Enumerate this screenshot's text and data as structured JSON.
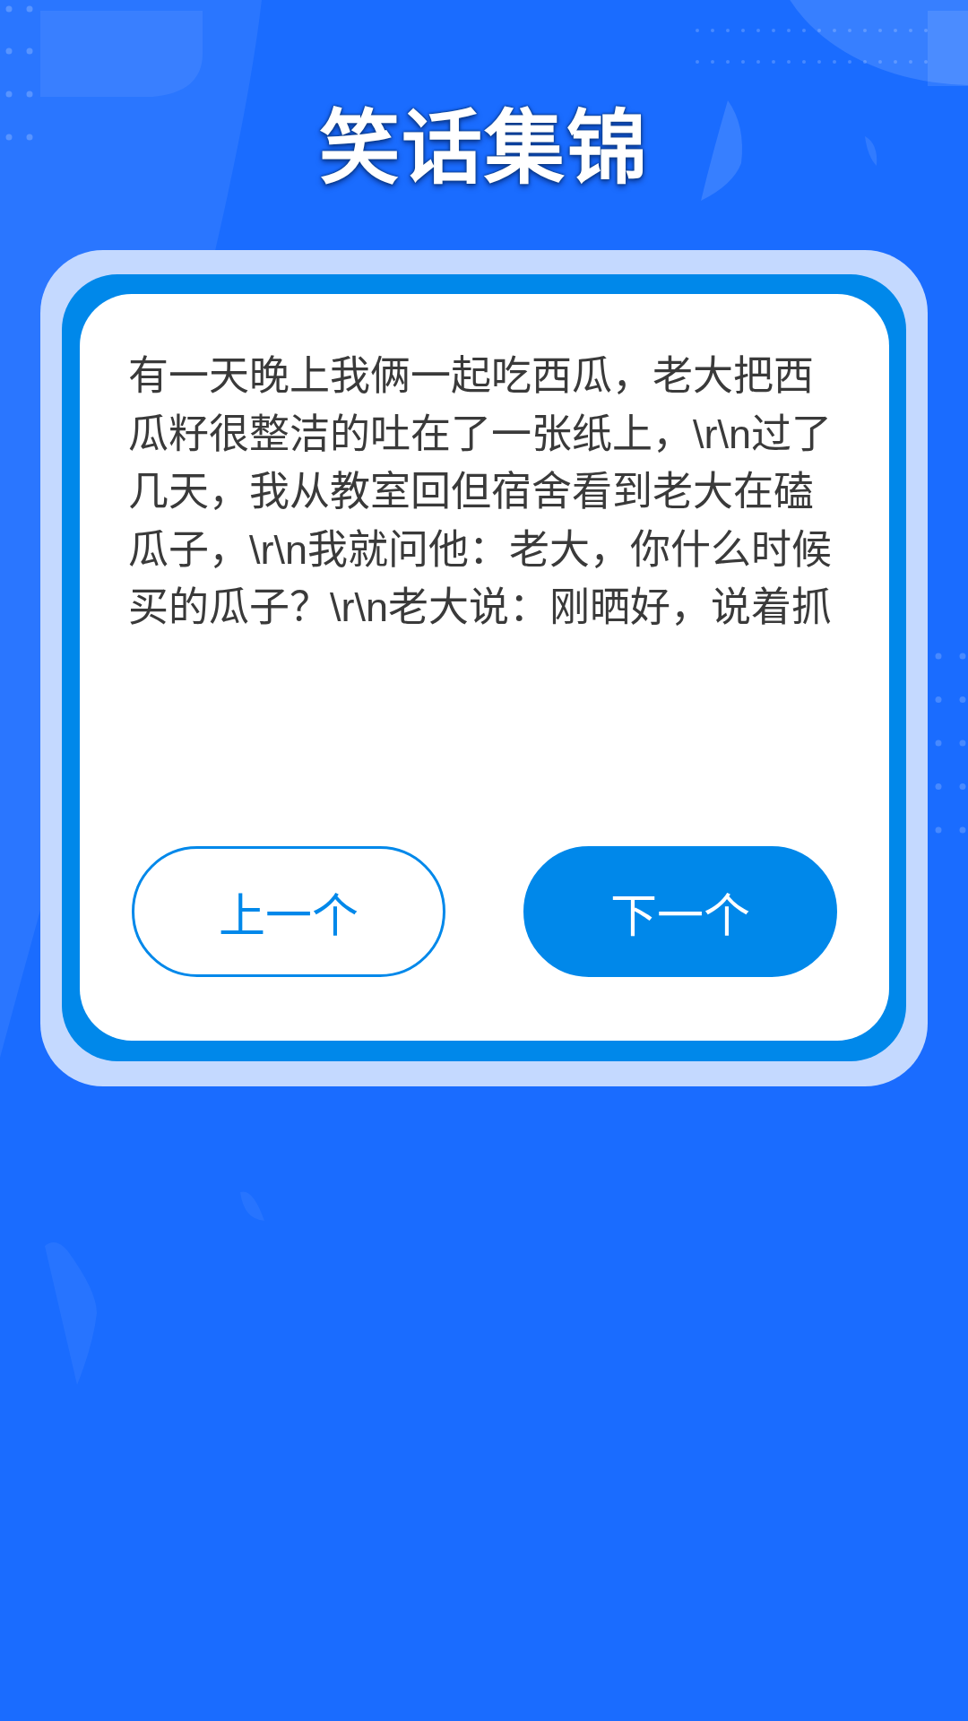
{
  "title": "笑话集锦",
  "joke": {
    "text": "有一天晚上我俩一起吃西瓜，老大把西瓜籽很整洁的吐在了一张纸上，\\r\\n过了几天，我从教室回但宿舍看到老大在磕瓜子，\\r\\n我就问他：老大，你什么时候买的瓜子？\\r\\n老大说：刚晒好，说着抓"
  },
  "buttons": [
    {
      "label": "上一个",
      "kind": "outline"
    },
    {
      "label": "下一个",
      "kind": "filled"
    }
  ]
}
